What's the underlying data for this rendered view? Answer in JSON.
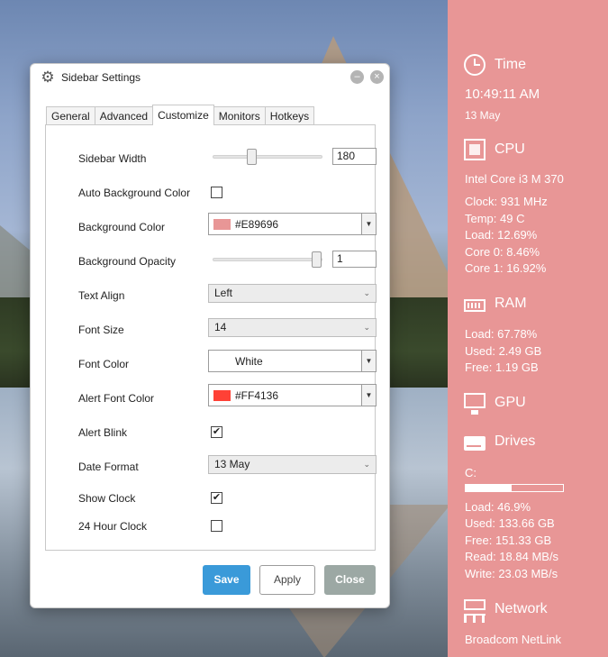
{
  "dialog": {
    "title": "Sidebar Settings",
    "minimize_glyph": "–",
    "close_glyph": "×",
    "tabs": [
      {
        "label": "General"
      },
      {
        "label": "Advanced"
      },
      {
        "label": "Customize"
      },
      {
        "label": "Monitors"
      },
      {
        "label": "Hotkeys"
      }
    ],
    "active_tab": "Customize",
    "settings": {
      "sidebar_width": {
        "label": "Sidebar Width",
        "value": "180",
        "slider_fraction": 0.34
      },
      "auto_background_color": {
        "label": "Auto Background Color",
        "checked": false
      },
      "background_color": {
        "label": "Background Color",
        "value": "#E89696"
      },
      "background_opacity": {
        "label": "Background Opacity",
        "value": "1",
        "slider_fraction": 1.0
      },
      "text_align": {
        "label": "Text Align",
        "value": "Left"
      },
      "font_size": {
        "label": "Font Size",
        "value": "14"
      },
      "font_color": {
        "label": "Font Color",
        "value": "White"
      },
      "alert_font_color": {
        "label": "Alert Font Color",
        "value": "#FF4136"
      },
      "alert_blink": {
        "label": "Alert Blink",
        "checked": true
      },
      "date_format": {
        "label": "Date Format",
        "value": "13 May"
      },
      "show_clock": {
        "label": "Show Clock",
        "checked": true
      },
      "hour24_clock": {
        "label": "24 Hour Clock",
        "checked": false
      }
    },
    "buttons": {
      "save": "Save",
      "apply": "Apply",
      "close": "Close"
    },
    "check_glyph": "✔",
    "dropdown_glyph": "▼",
    "chevron_glyph": "⌄"
  },
  "sidebar": {
    "background": "#E89696",
    "time": {
      "heading": "Time",
      "clock": "10:49:11 AM",
      "date": "13 May"
    },
    "cpu": {
      "heading": "CPU",
      "name": "Intel Core i3 M 370",
      "clock": "Clock: 931 MHz",
      "temp": "Temp: 49 C",
      "load": "Load: 12.69%",
      "core0": "Core 0: 8.46%",
      "core1": "Core 1: 16.92%"
    },
    "ram": {
      "heading": "RAM",
      "load": "Load: 67.78%",
      "used": "Used: 2.49 GB",
      "free": "Free: 1.19 GB"
    },
    "gpu": {
      "heading": "GPU"
    },
    "drives": {
      "heading": "Drives",
      "drive": "C:",
      "usage_fraction": 0.469,
      "load": "Load: 46.9%",
      "used": "Used: 133.66 GB",
      "free": "Free: 151.33 GB",
      "read": "Read: 18.84 MB/s",
      "write": "Write: 23.03 MB/s"
    },
    "network": {
      "heading": "Network",
      "adapter": "Broadcom NetLink"
    }
  },
  "icons": {
    "settings": "gear-icon",
    "time": "clock-icon",
    "cpu": "cpu-icon",
    "ram": "ram-icon",
    "gpu": "monitor-icon",
    "drives": "drive-icon",
    "network": "network-icon"
  }
}
